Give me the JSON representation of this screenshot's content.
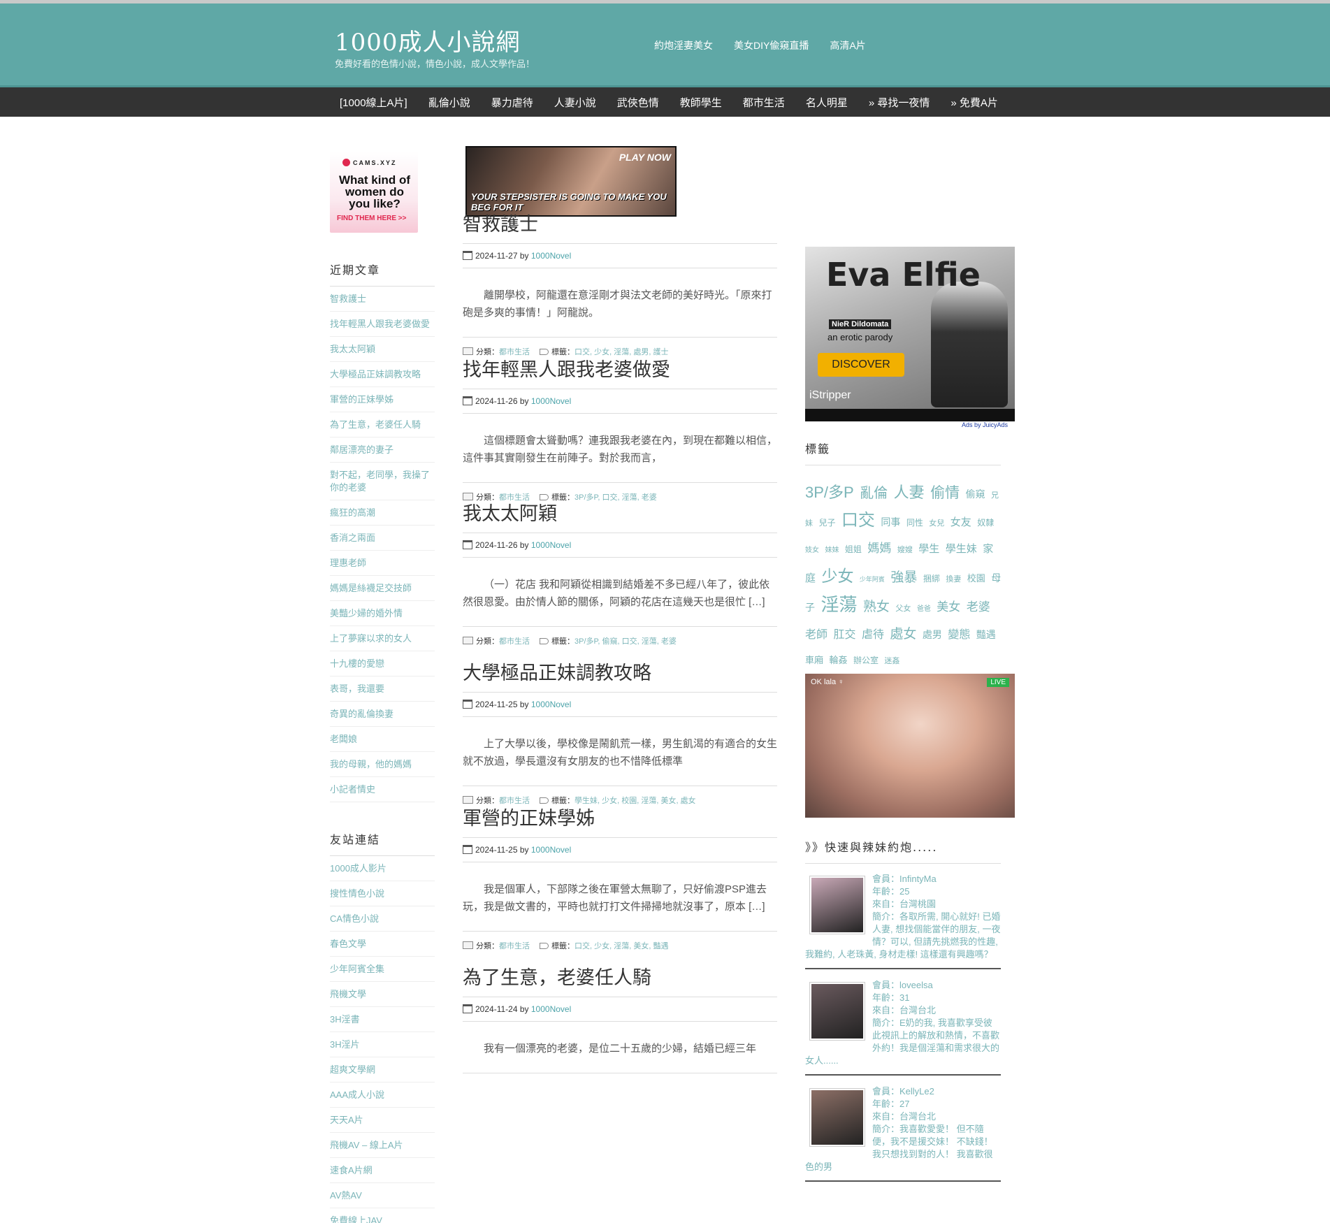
{
  "site": {
    "title": "1000成人小說網",
    "description": "免費好看的色情小說，情色小說，成人文學作品！",
    "top_links": [
      "約炮淫妻美女",
      "美女DIY偸窺直播",
      "高清A片"
    ]
  },
  "nav": [
    "[1000線上A片]",
    "亂倫小說",
    "暴力虐待",
    "人妻小說",
    "武俠色情",
    "教師學生",
    "都市生活",
    "名人明星",
    "» 尋找一夜情",
    "» 免費A片"
  ],
  "ads": {
    "cams": {
      "brand": "CAMS.XYZ",
      "question": "What kind of women do you like?",
      "cta": "FIND THEM HERE >>"
    },
    "banner": {
      "play": "PLAY NOW",
      "tagline": "YOUR STEPSISTER IS GOING TO MAKE YOU BEG FOR IT"
    },
    "eva": {
      "title": "Eva Elfie",
      "sub1": "NieR Dildomata",
      "sub2": "an erotic parody",
      "button": "DISCOVER",
      "brand": "iStripper",
      "credit": "Ads by JuicyAds"
    },
    "cam": {
      "name": "OK lala ♀",
      "live": "LIVE"
    }
  },
  "left": {
    "recent_title": "近期文章",
    "recent": [
      "智救護士",
      "找年輕黑人跟我老婆做愛",
      "我太太阿穎",
      "大學極品正妹調教攻略",
      "軍營的正妹學姊",
      "為了生意，老婆任人騎",
      "鄰居漂亮的妻子",
      "對不起，老同學，我操了你的老婆",
      "瘋狂的高潮",
      "香消之兩面",
      "理惠老師",
      "媽媽是絲襪足交技師",
      "美豔少婦的婚外情",
      "上了夢寐以求的女人",
      "十九樓的愛戀",
      "表哥，我還要",
      "奇異的亂倫換妻",
      "老闆娘",
      "我的母親，他的媽媽",
      "小記者情史"
    ],
    "links_title": "友站連結",
    "links": [
      "1000成人影片",
      "搜性情色小說",
      "CA情色小說",
      "春色文學",
      "少年阿賓全集",
      "飛機文學",
      "3H淫書",
      "3H淫片",
      "超爽文學網",
      "AAA成人小說",
      "天天A片",
      "飛機AV – 線上A片",
      "速食A片網",
      "AV熱AV",
      "免費線上JAV"
    ]
  },
  "posts": [
    {
      "title": "智救護士",
      "date": "2024-11-27",
      "by": "by",
      "author": "1000Novel",
      "excerpt": "離開學校，阿龍還在意淫剛才與法文老師的美好時光。「原來打砲是多爽的事情！」阿龍說。",
      "cat_label": "分類：",
      "cat": "都市生活",
      "tag_label": "標籤：",
      "tags": "口交, 少女, 淫蕩, 處男, 護士"
    },
    {
      "title": "找年輕黑人跟我老婆做愛",
      "date": "2024-11-26",
      "by": "by",
      "author": "1000Novel",
      "excerpt": "這個標題會太聳動嗎？連我跟我老婆在內，到現在都難以相信，這件事其實剛發生在前陣子。對於我而言，",
      "cat_label": "分類：",
      "cat": "都市生活",
      "tag_label": "標籤：",
      "tags": "3P/多P, 口交, 淫蕩, 老婆"
    },
    {
      "title": "我太太阿穎",
      "date": "2024-11-26",
      "by": "by",
      "author": "1000Novel",
      "excerpt": "（一）花店 我和阿穎從相識到結婚差不多已經八年了，彼此依然很恩愛。由於情人節的關係，阿穎的花店在這幾天也是很忙 […]",
      "cat_label": "分類：",
      "cat": "都市生活",
      "tag_label": "標籤：",
      "tags": "3P/多P, 偷窺, 口交, 淫蕩, 老婆"
    },
    {
      "title": "大學極品正妹調教攻略",
      "date": "2024-11-25",
      "by": "by",
      "author": "1000Novel",
      "excerpt": "上了大學以後，學校像是鬧飢荒一樣，男生飢渴的有適合的女生就不放過，學長還沒有女朋友的也不惜降低標準",
      "cat_label": "分類：",
      "cat": "都市生活",
      "tag_label": "標籤：",
      "tags": "學生妹, 少女, 校園, 淫蕩, 美女, 處女"
    },
    {
      "title": "軍營的正妹學姊",
      "date": "2024-11-25",
      "by": "by",
      "author": "1000Novel",
      "excerpt": "我是個軍人，下部隊之後在軍營太無聊了，只好偷渡PSP進去玩，我是做文書的，平時也就打打文件掃掃地就沒事了，原本 […]",
      "cat_label": "分類：",
      "cat": "都市生活",
      "tag_label": "標籤：",
      "tags": "口交, 少女, 淫蕩, 美女, 豔遇"
    },
    {
      "title": "為了生意，老婆任人騎",
      "date": "2024-11-24",
      "by": "by",
      "author": "1000Novel",
      "excerpt": "我有一個漂亮的老婆，是位二十五歲的少婦，結婚已經三年",
      "cat_label": "",
      "cat": "",
      "tag_label": "",
      "tags": ""
    }
  ],
  "right": {
    "tags_title": "標籤",
    "tags": [
      {
        "t": "3P/多P",
        "s": 22
      },
      {
        "t": "亂倫",
        "s": 20
      },
      {
        "t": "人妻",
        "s": 22
      },
      {
        "t": "偷情",
        "s": 21
      },
      {
        "t": "偷窺",
        "s": 14
      },
      {
        "t": "兄妹",
        "s": 11
      },
      {
        "t": "兒子",
        "s": 12
      },
      {
        "t": "口交",
        "s": 24
      },
      {
        "t": "同事",
        "s": 14
      },
      {
        "t": "同性",
        "s": 12
      },
      {
        "t": "女兒",
        "s": 11
      },
      {
        "t": "女友",
        "s": 15
      },
      {
        "t": "奴隸",
        "s": 12
      },
      {
        "t": "妓女",
        "s": 10
      },
      {
        "t": "妹妹",
        "s": 10
      },
      {
        "t": "姐姐",
        "s": 12
      },
      {
        "t": "媽媽",
        "s": 17
      },
      {
        "t": "嫂嫂",
        "s": 11
      },
      {
        "t": "學生",
        "s": 15
      },
      {
        "t": "學生妹",
        "s": 15
      },
      {
        "t": "家庭",
        "s": 15
      },
      {
        "t": "少女",
        "s": 23
      },
      {
        "t": "少年阿賓",
        "s": 9
      },
      {
        "t": "強暴",
        "s": 19
      },
      {
        "t": "捆綁",
        "s": 12
      },
      {
        "t": "換妻",
        "s": 11
      },
      {
        "t": "校園",
        "s": 13
      },
      {
        "t": "母子",
        "s": 14
      },
      {
        "t": "淫蕩",
        "s": 26
      },
      {
        "t": "熟女",
        "s": 19
      },
      {
        "t": "父女",
        "s": 11
      },
      {
        "t": "爸爸",
        "s": 10
      },
      {
        "t": "美女",
        "s": 17
      },
      {
        "t": "老婆",
        "s": 17
      },
      {
        "t": "老師",
        "s": 16
      },
      {
        "t": "肛交",
        "s": 16
      },
      {
        "t": "虐待",
        "s": 16
      },
      {
        "t": "處女",
        "s": 19
      },
      {
        "t": "處男",
        "s": 14
      },
      {
        "t": "變態",
        "s": 16
      },
      {
        "t": "豔遇",
        "s": 14
      },
      {
        "t": "車廂",
        "s": 13
      },
      {
        "t": "輪姦",
        "s": 13
      },
      {
        "t": "辦公室",
        "s": 12
      },
      {
        "t": "迷姦",
        "s": 11
      }
    ],
    "dating_title": "》》快速與辣妹約炮.....",
    "members": [
      {
        "name": "會員：InfintyMa",
        "age": "年齡：25",
        "from": "來自：台灣桃園",
        "intro": "簡介：各取所需, 開心就好! 已婚人妻, 想找個能當伴的朋友, 一夜情？可以, 但請先挑燃我的性趣, 我難約, 人老珠黃, 身材走樣! 這樣還有興趣嗎？",
        "c": "#c9a9b7"
      },
      {
        "name": "會員：loveelsa",
        "age": "年齡：31",
        "from": "來自：台灣台北",
        "intro": "簡介：E奶的我, 我喜歡享受彼此視訊上的解放和熱情，不喜歡外約！我是個淫蕩和需求很大的女人......",
        "c": "#6a5a5e"
      },
      {
        "name": "會員：KellyLe2",
        "age": "年齡：27",
        "from": "來自：台灣台北",
        "intro": "簡介：我喜歡愛愛！ 但不隨便，我不是援交妹！ 不缺錢！ 我只想找到對的人！ 我喜歡很色的男",
        "c": "#8c6f66"
      }
    ]
  }
}
